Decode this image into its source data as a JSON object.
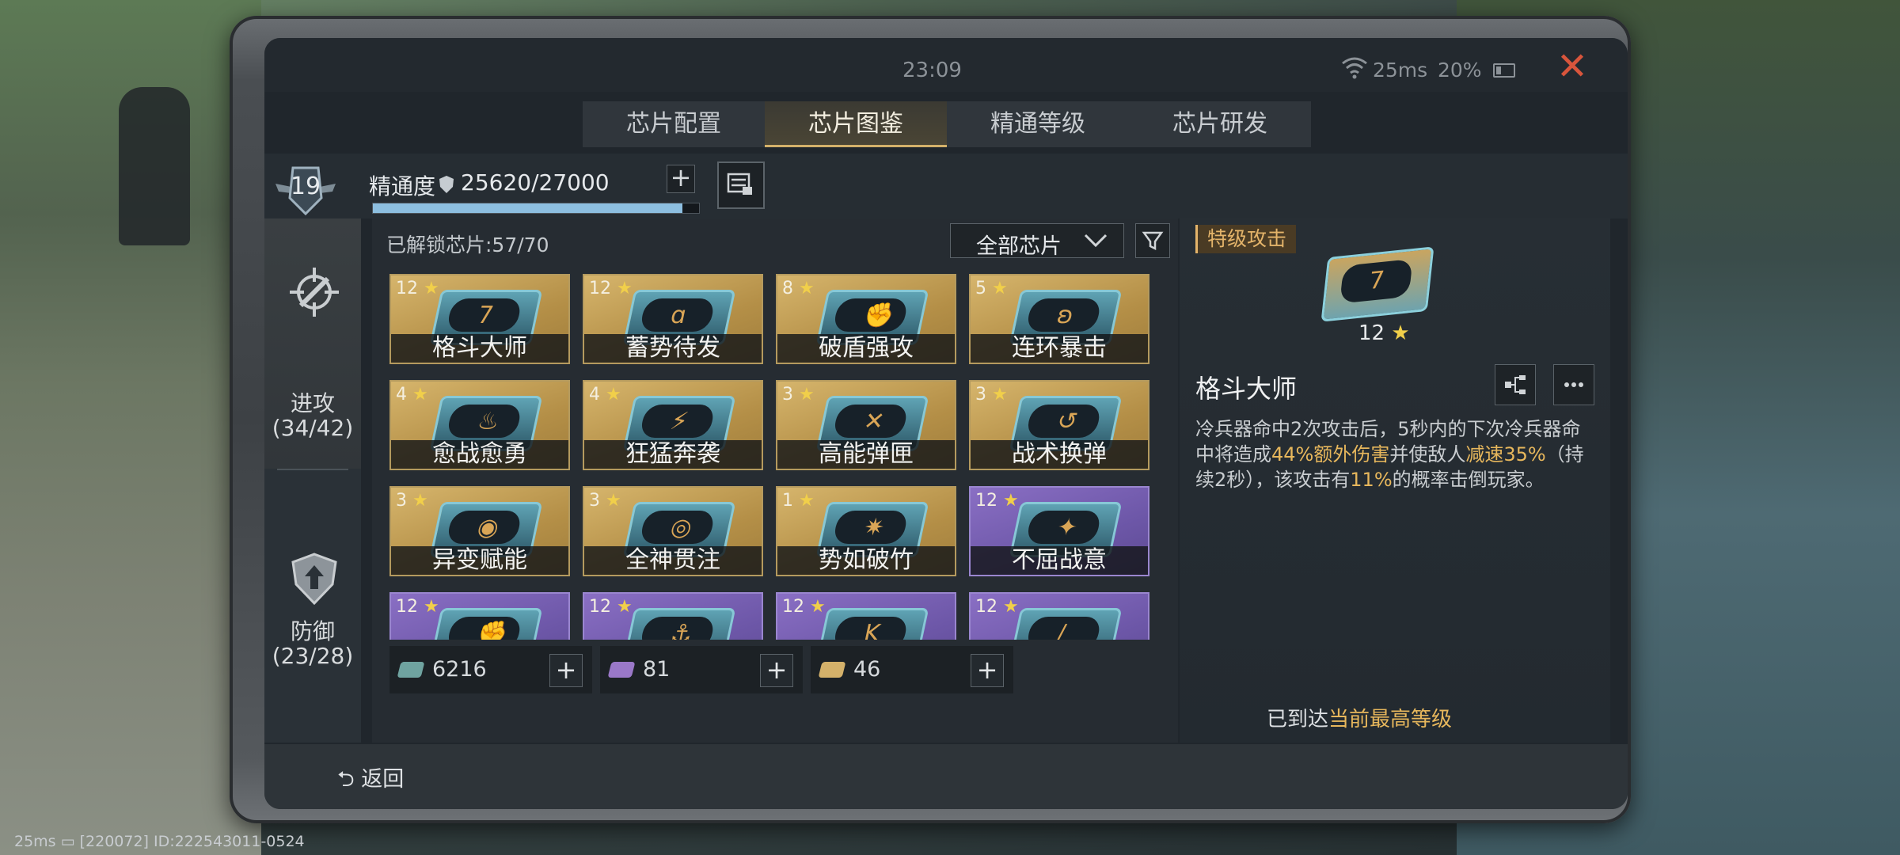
{
  "status": {
    "clock": "23:09",
    "ping": "25ms",
    "battery": "20%"
  },
  "tabs": [
    {
      "label": "芯片配置"
    },
    {
      "label": "芯片图鉴"
    },
    {
      "label": "精通等级"
    },
    {
      "label": "芯片研发"
    }
  ],
  "mastery": {
    "level": "19",
    "label": "精通度",
    "value": "25620/27000",
    "progress": 0.949
  },
  "categories": {
    "attack": {
      "name": "进攻",
      "count": "(34/42)"
    },
    "defense": {
      "name": "防御",
      "count": "(23/28)"
    }
  },
  "grid": {
    "unlocked": "已解锁芯片:57/70",
    "filter": "全部芯片",
    "cards": [
      {
        "stars": "12",
        "name": "格斗大师",
        "glyph": "7"
      },
      {
        "stars": "12",
        "name": "蓄势待发",
        "glyph": "ɑ"
      },
      {
        "stars": "8",
        "name": "破盾强攻",
        "glyph": "✊"
      },
      {
        "stars": "5",
        "name": "连环暴击",
        "glyph": "ʚ"
      },
      {
        "stars": "4",
        "name": "愈战愈勇",
        "glyph": "♨"
      },
      {
        "stars": "4",
        "name": "狂猛奔袭",
        "glyph": "⚡"
      },
      {
        "stars": "3",
        "name": "高能弹匣",
        "glyph": "✕"
      },
      {
        "stars": "3",
        "name": "战术换弹",
        "glyph": "↺"
      },
      {
        "stars": "3",
        "name": "异变赋能",
        "glyph": "◉"
      },
      {
        "stars": "3",
        "name": "全神贯注",
        "glyph": "◎"
      },
      {
        "stars": "1",
        "name": "势如破竹",
        "glyph": "✷"
      },
      {
        "stars": "12",
        "name": "不屈战意",
        "glyph": "✦"
      },
      {
        "stars": "12",
        "name": "",
        "glyph": "✊"
      },
      {
        "stars": "12",
        "name": "",
        "glyph": "⚓"
      },
      {
        "stars": "12",
        "name": "",
        "glyph": "K"
      },
      {
        "stars": "12",
        "name": "",
        "glyph": "/"
      }
    ]
  },
  "resources": [
    {
      "value": "6216",
      "color": "#6fa3a0"
    },
    {
      "value": "81",
      "color": "#9a78c8"
    },
    {
      "value": "46",
      "color": "#d4b16a"
    }
  ],
  "detail": {
    "tier": "特级攻击",
    "stars": "12",
    "title": "格斗大师",
    "desc_1": "冷兵器命中2次攻击后，5秒内的下次冷兵器命中将造成",
    "desc_hl1": "44%额外伤害",
    "desc_2": "并使敌人",
    "desc_hl2": "减速35%",
    "desc_3": "（持续2秒），该攻击有",
    "desc_hl3": "11%",
    "desc_4": "的概率击倒玩家。",
    "max_prefix": "已到达",
    "max_hl": "当前最高等级"
  },
  "bottom": {
    "back": "返回"
  },
  "footer": {
    "text": "25ms ▭ [220072] ID:222543011-0524"
  }
}
